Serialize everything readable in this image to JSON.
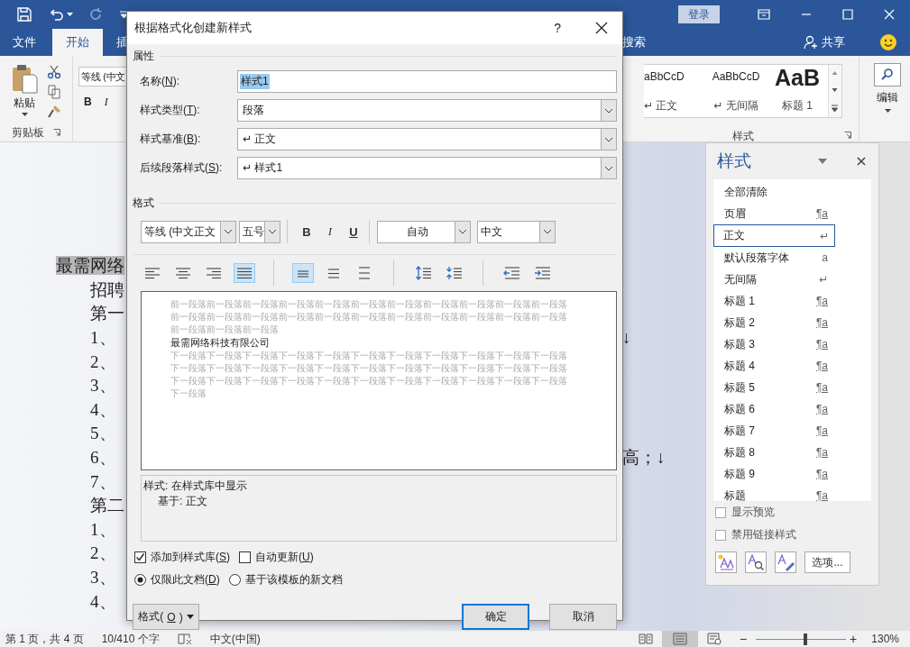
{
  "window": {
    "login_button": "登录",
    "tabs": [
      {
        "label": "文件",
        "selected": false
      },
      {
        "label": "开始",
        "selected": true
      },
      {
        "label": "插",
        "selected": false
      }
    ],
    "search_label": "搜索",
    "share_button": "共享"
  },
  "ribbon": {
    "paste_button": "粘贴",
    "font_name": "等线 (中文",
    "bold_button": "B",
    "italic_button": "I",
    "clipboard_group": "剪贴板",
    "gallery": [
      {
        "sample": "aBbCcD",
        "name": "↵ 正文",
        "kind": "normal"
      },
      {
        "sample": "AaBbCcD",
        "name": "↵ 无间隔",
        "kind": "normal"
      },
      {
        "sample": "AaB",
        "name": "标题 1",
        "kind": "heading"
      }
    ],
    "styles_group": "样式",
    "editing_button": "编辑"
  },
  "document": {
    "lines": [
      {
        "text": "最需网络",
        "kind": "title",
        "highlighted": true
      },
      {
        "text": "招聘",
        "kind": "body",
        "highlighted": false
      },
      {
        "text": "第一",
        "kind": "body",
        "highlighted": false
      },
      {
        "text": "1、",
        "kind": "body",
        "highlighted": false,
        "tail": "↓"
      },
      {
        "text": "2、",
        "kind": "body",
        "highlighted": false
      },
      {
        "text": "3、",
        "kind": "body",
        "highlighted": false
      },
      {
        "text": "4、",
        "kind": "body",
        "highlighted": false
      },
      {
        "text": "5、",
        "kind": "body",
        "highlighted": false
      },
      {
        "text": "6、",
        "kind": "body",
        "highlighted": false,
        "tail": "高；↓"
      },
      {
        "text": "7、",
        "kind": "body",
        "highlighted": false
      },
      {
        "text": "第二",
        "kind": "body",
        "highlighted": false
      },
      {
        "text": "1、",
        "kind": "body",
        "highlighted": false
      },
      {
        "text": "2、",
        "kind": "body",
        "highlighted": false
      },
      {
        "text": "3、",
        "kind": "body",
        "highlighted": false
      },
      {
        "text": "4、",
        "kind": "body",
        "highlighted": false
      }
    ]
  },
  "dialog": {
    "title": "根据格式化创建新样式",
    "help_button": "?",
    "properties_heading": "属性",
    "fields": [
      {
        "pre": "名称(",
        "key": "N",
        "post": "):",
        "value": "样式1",
        "kind": "text",
        "highlighted": true
      },
      {
        "pre": "样式类型(",
        "key": "T",
        "post": "):",
        "value": "段落",
        "kind": "dropdown",
        "highlighted": false
      },
      {
        "pre": "样式基准(",
        "key": "B",
        "post": "):",
        "value": "↵ 正文",
        "kind": "dropdown",
        "highlighted": false
      },
      {
        "pre": "后续段落样式(",
        "key": "S",
        "post": "):",
        "value": "↵ 样式1",
        "kind": "dropdown",
        "highlighted": false
      }
    ],
    "format_heading": "格式",
    "font": "等线 (中文正文",
    "size": "五号",
    "bold_button": "B",
    "italic_button": "I",
    "underline_button": "U",
    "font_color_setting": "自动",
    "script": "中文",
    "paragraph_button_groups": [
      [
        {
          "kind": "align-left",
          "selected": false
        },
        {
          "kind": "align-center",
          "selected": false
        },
        {
          "kind": "align-right",
          "selected": false
        },
        {
          "kind": "justify",
          "selected": true
        }
      ],
      [
        {
          "kind": "single-spacing",
          "selected": true
        },
        {
          "kind": "one-half-spacing",
          "selected": false
        },
        {
          "kind": "double-spacing",
          "selected": false
        }
      ],
      [
        {
          "kind": "space-increase",
          "selected": false
        },
        {
          "kind": "space-decrease",
          "selected": false
        }
      ],
      [
        {
          "kind": "indent-decrease",
          "selected": false
        },
        {
          "kind": "indent-increase",
          "selected": false
        }
      ]
    ],
    "preview": {
      "before": [
        "前一段落前一段落前一段落前一段落前一段落前一段落前一段落前一段落前一段落前一段落前一段落",
        "前一段落前一段落前一段落前一段落前一段落前一段落前一段落前一段落前一段落前一段落前一段落",
        "前一段落前一段落前一段落"
      ],
      "sample": "最需网络科技有限公司",
      "after": [
        "下一段落下一段落下一段落下一段落下一段落下一段落下一段落下一段落下一段落下一段落下一段落",
        "下一段落下一段落下一段落下一段落下一段落下一段落下一段落下一段落下一段落下一段落下一段落",
        "下一段落下一段落下一段落下一段落下一段落下一段落下一段落下一段落下一段落下一段落下一段落",
        "下一段落"
      ]
    },
    "description": [
      {
        "text": "样式: 在样式库中显示",
        "kind": "main"
      },
      {
        "text": "基于: 正文",
        "kind": "detail"
      }
    ],
    "checkboxes": [
      {
        "pre": "添加到样式库(",
        "key": "S",
        "post": ")",
        "checked": true
      },
      {
        "pre": "自动更新(",
        "key": "U",
        "post": ")",
        "checked": false
      }
    ],
    "radios": [
      {
        "pre": "仅限此文档(",
        "key": "D",
        "post": ")",
        "selected": true
      },
      {
        "pre": "基于该模板的新文档",
        "selected": false
      }
    ],
    "format_button": {
      "pre": "格式(",
      "key": "O",
      "post": ")"
    },
    "ok_button": "确定",
    "cancel_button": "取消"
  },
  "styles_pane": {
    "title": "样式",
    "items": [
      {
        "name": "全部清除",
        "kind": "clear",
        "selected": false
      },
      {
        "name": "页眉",
        "symbol": "¶a",
        "kind": "linked",
        "selected": false
      },
      {
        "name": "正文",
        "symbol": "↵",
        "kind": "paragraph",
        "selected": true
      },
      {
        "name": "默认段落字体",
        "symbol": "a",
        "kind": "character",
        "selected": false
      },
      {
        "name": "无间隔",
        "symbol": "↵",
        "kind": "paragraph",
        "selected": false
      },
      {
        "name": "标题 1",
        "symbol": "¶a",
        "kind": "linked",
        "selected": false
      },
      {
        "name": "标题 2",
        "symbol": "¶a",
        "kind": "linked",
        "selected": false
      },
      {
        "name": "标题 3",
        "symbol": "¶a",
        "kind": "linked",
        "selected": false
      },
      {
        "name": "标题 4",
        "symbol": "¶a",
        "kind": "linked",
        "selected": false
      },
      {
        "name": "标题 5",
        "symbol": "¶a",
        "kind": "linked",
        "selected": false
      },
      {
        "name": "标题 6",
        "symbol": "¶a",
        "kind": "linked",
        "selected": false
      },
      {
        "name": "标题 7",
        "symbol": "¶a",
        "kind": "linked",
        "selected": false
      },
      {
        "name": "标题 8",
        "symbol": "¶a",
        "kind": "linked",
        "selected": false
      },
      {
        "name": "标题 9",
        "symbol": "¶a",
        "kind": "linked",
        "selected": false
      },
      {
        "name": "标题",
        "symbol": "¶a",
        "kind": "linked",
        "selected": false
      }
    ],
    "checkboxes": [
      {
        "label": "显示预览",
        "checked": false
      },
      {
        "label": "禁用链接样式",
        "checked": false
      }
    ],
    "options_button": "选项..."
  },
  "status_bar": {
    "page": "第 1 页，共 4 页",
    "words": "10/410 个字",
    "language": "中文(中国)",
    "zoom_out": "−",
    "zoom_in": "+",
    "zoom": {
      "level": 0.55
    },
    "zoom_label": "130%"
  }
}
